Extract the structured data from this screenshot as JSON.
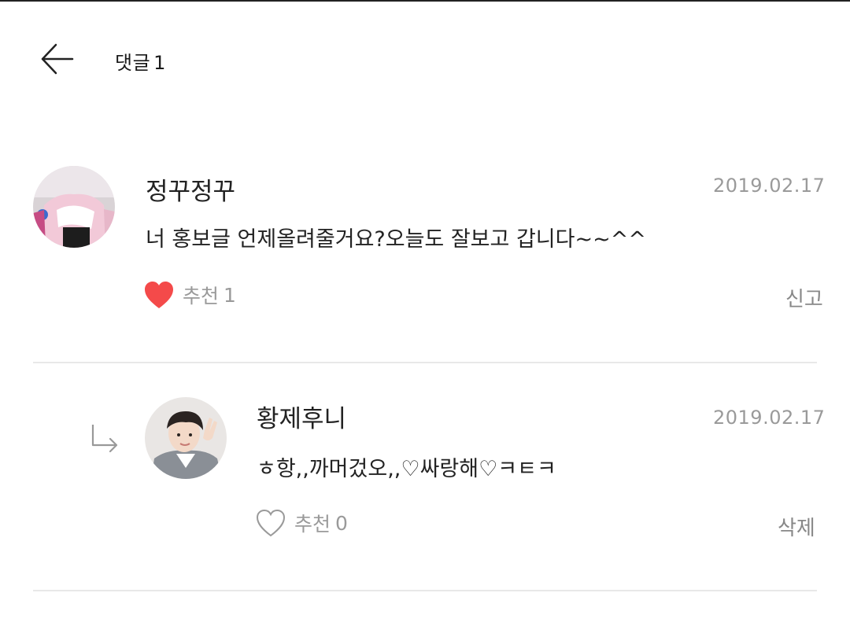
{
  "header": {
    "title": "댓글",
    "count": "1"
  },
  "comments": [
    {
      "author": "정꾸정꾸",
      "date": "2019.02.17",
      "text": "너 홍보글 언제올려줄거요?오늘도 잘보고 갑니다~~^^",
      "like_label": "추천",
      "like_count": "1",
      "liked": true,
      "action": "신고"
    }
  ],
  "replies": [
    {
      "author": "황제후니",
      "date": "2019.02.17",
      "text": "ㅎ항,,까머겄오,,♡싸랑해♡ㅋㅌㅋ",
      "like_label": "추천",
      "like_count": "0",
      "liked": false,
      "action": "삭제"
    }
  ],
  "colors": {
    "like_active": "#f44a4a",
    "like_inactive": "#9a9a9a",
    "meta_text": "#9a9a9a",
    "divider": "#e8e8e8"
  }
}
